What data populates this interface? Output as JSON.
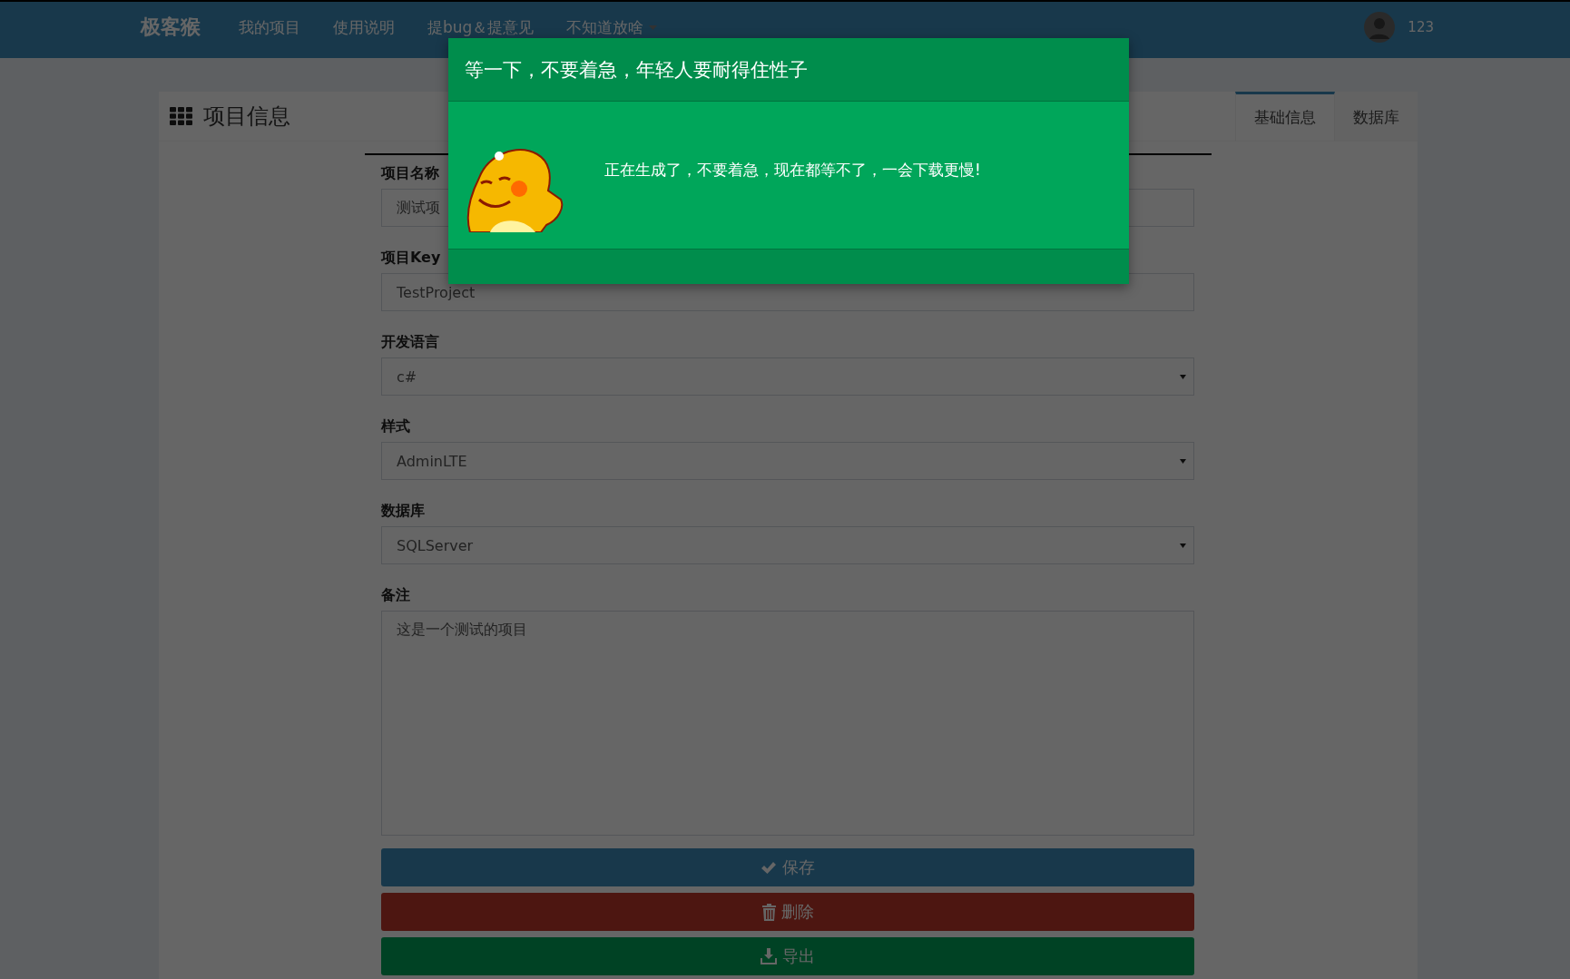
{
  "navbar": {
    "brand": "极客猴",
    "items": [
      {
        "label": "我的项目",
        "dropdown": false
      },
      {
        "label": "使用说明",
        "dropdown": false
      },
      {
        "label": "提bug＆提意见",
        "dropdown": false
      },
      {
        "label": "不知道放啥",
        "dropdown": true
      }
    ],
    "user": "123"
  },
  "panel": {
    "title": "项目信息",
    "tabs": [
      {
        "label": "基础信息",
        "selected": true
      },
      {
        "label": "数据库",
        "selected": false
      }
    ]
  },
  "form": {
    "fields": [
      {
        "kind": "text",
        "label": "项目名称",
        "value": "测试项"
      },
      {
        "kind": "text",
        "label": "项目Key",
        "value": "TestProject"
      },
      {
        "kind": "select",
        "label": "开发语言",
        "value": "c#"
      },
      {
        "kind": "select",
        "label": "样式",
        "value": "AdminLTE"
      },
      {
        "kind": "select",
        "label": "数据库",
        "value": "SQLServer"
      },
      {
        "kind": "textarea",
        "label": "备注",
        "value": "这是一个测试的项目"
      }
    ],
    "buttons": [
      {
        "kind": "save",
        "label": "保存"
      },
      {
        "kind": "delete",
        "label": "删除"
      },
      {
        "kind": "export",
        "label": "导出"
      }
    ]
  },
  "modal": {
    "title": "等一下，不要着急，年轻人要耐得住性子",
    "message": "正在生成了，不要着急，现在都等不了，一会下载更慢!"
  }
}
